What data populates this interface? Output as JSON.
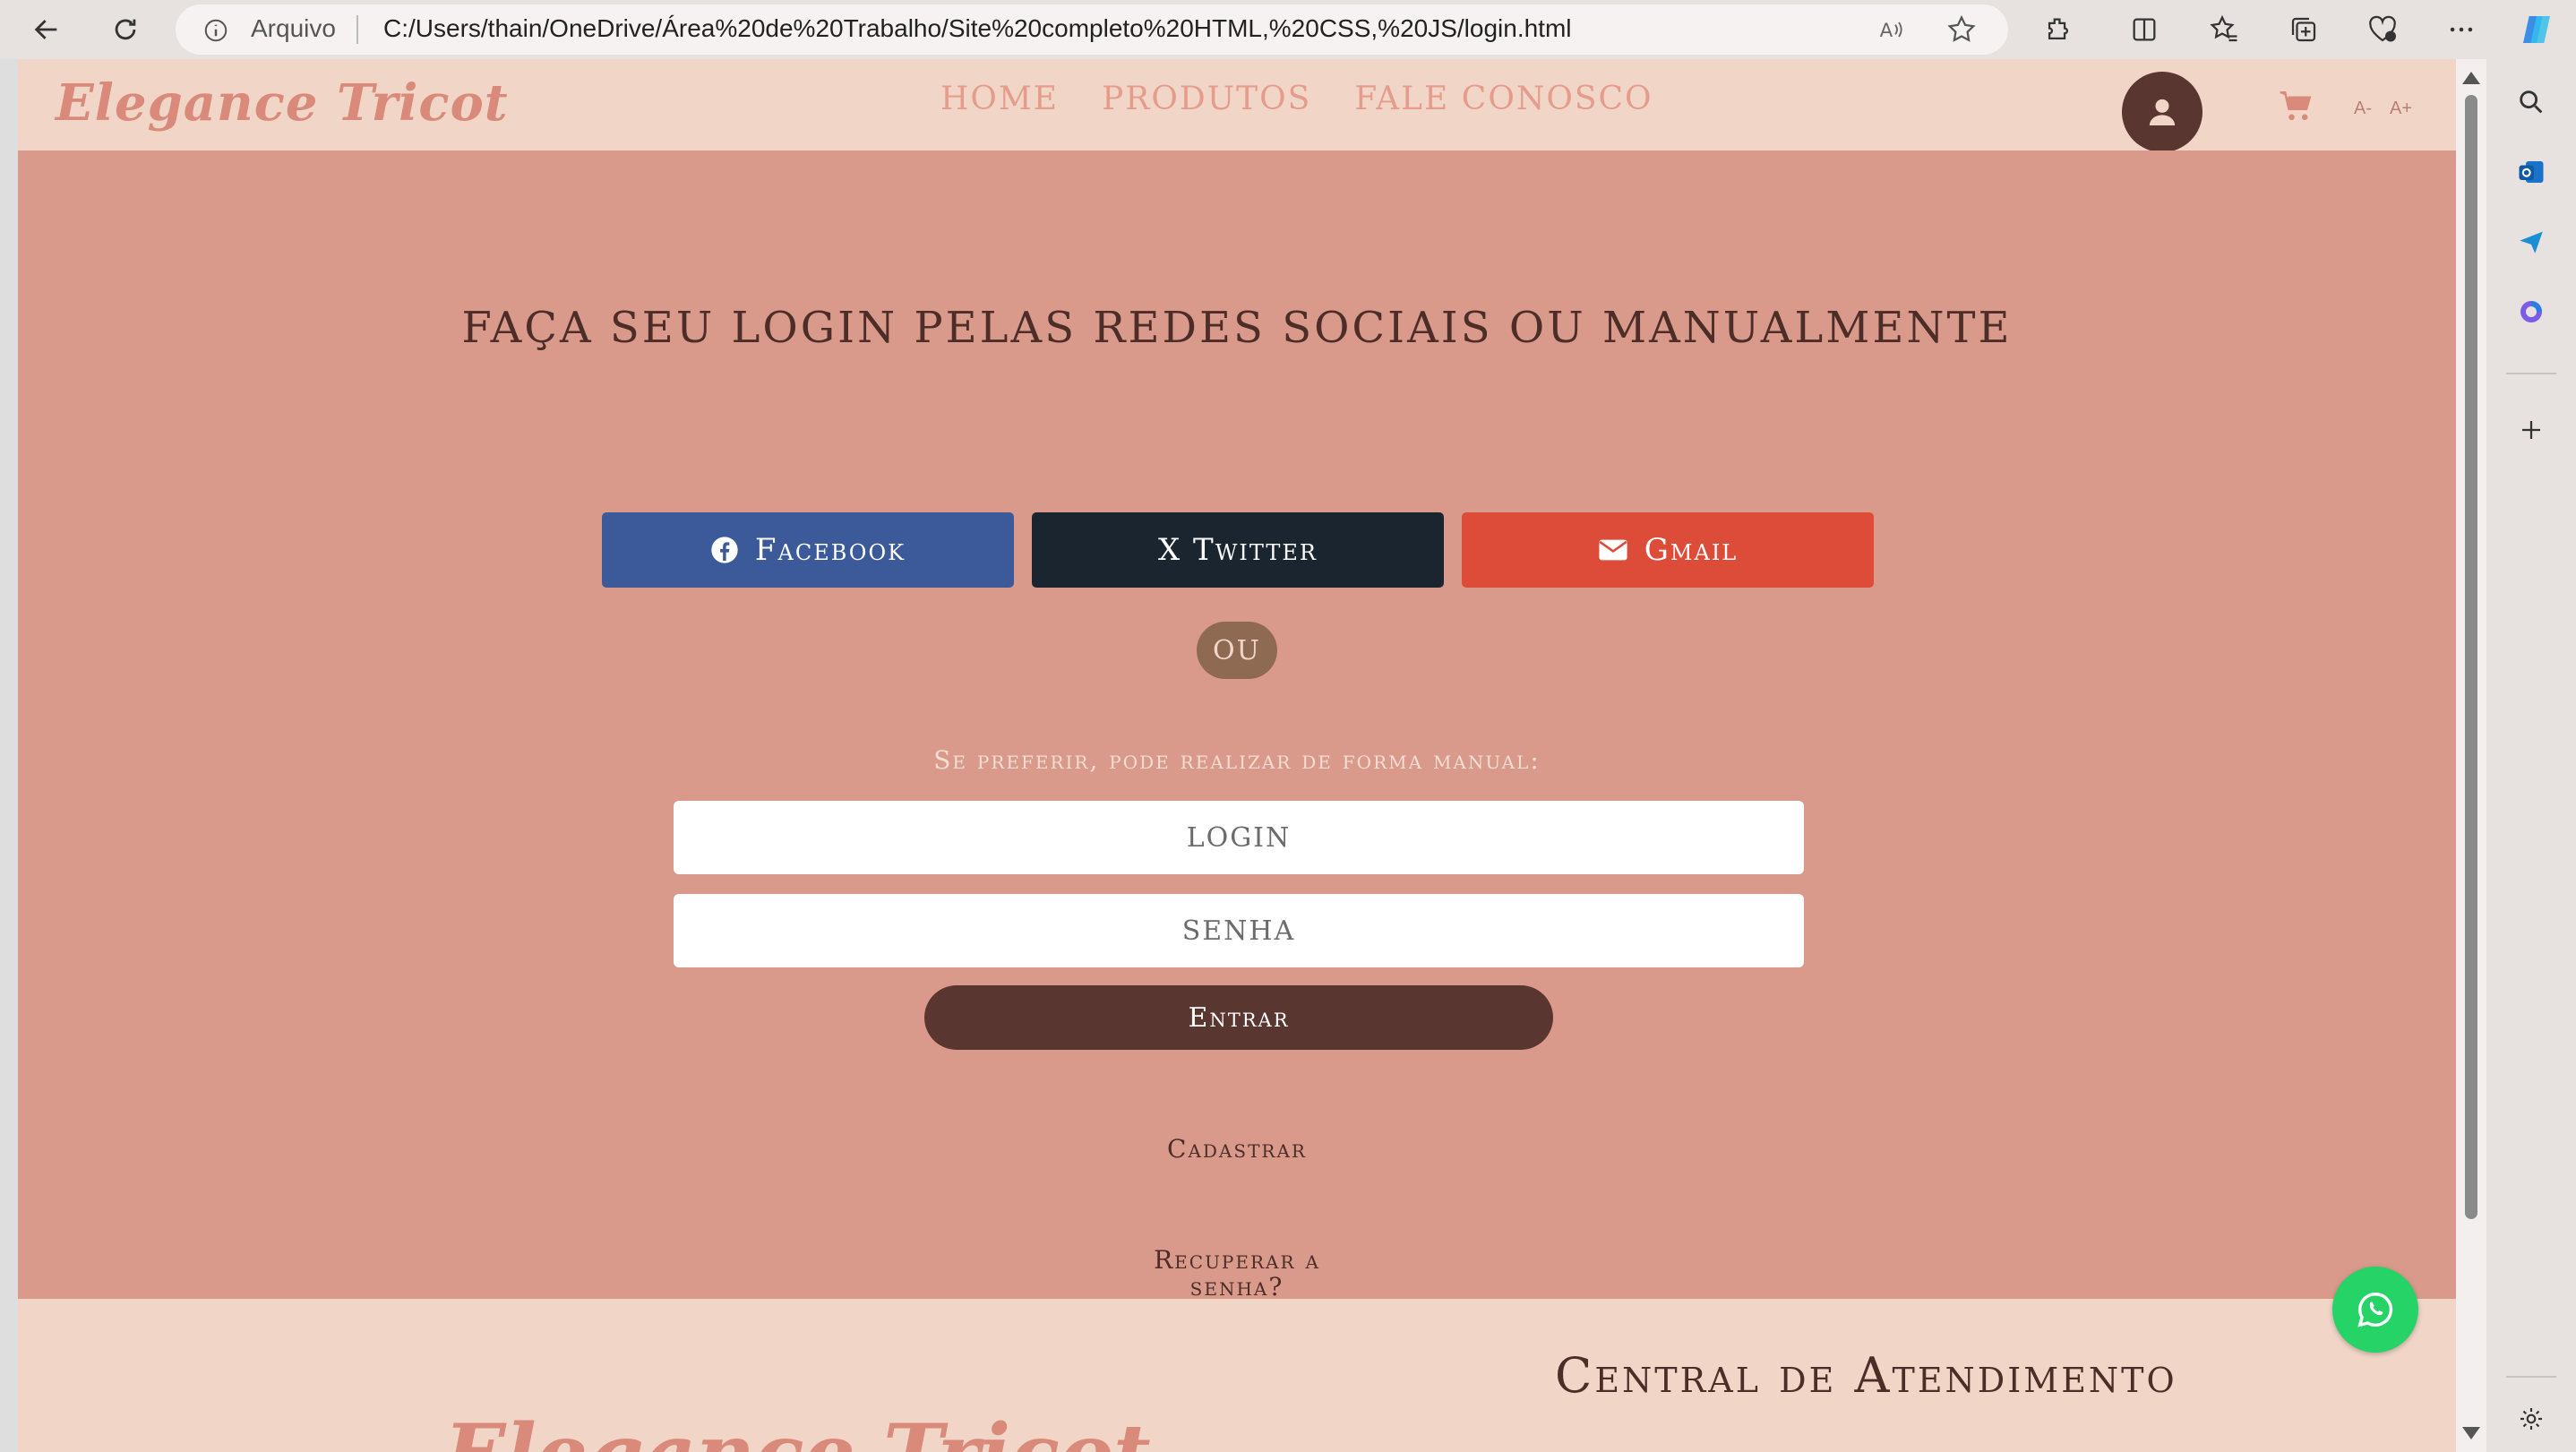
{
  "browser": {
    "address_label": "Arquivo",
    "url": "C:/Users/thain/OneDrive/Área%20de%20Trabalho/Site%20completo%20HTML,%20CSS,%20JS/login.html"
  },
  "site": {
    "logo": "Elegance Tricot",
    "nav": [
      "Home",
      "Produtos",
      "Fale Conosco"
    ],
    "font_decrease": "A-",
    "font_increase": "A+"
  },
  "login": {
    "title": "Faça seu login pelas redes sociais ou manualmente",
    "social": {
      "facebook": "Facebook",
      "twitter": "X Twitter",
      "gmail": "Gmail"
    },
    "or_label": "OU",
    "manual_hint": "Se preferir, pode realizar de forma manual:",
    "login_placeholder": "LOGIN",
    "password_placeholder": "SENHA",
    "submit": "Entrar",
    "register": "Cadastrar",
    "recover": "Recuperar a senha?"
  },
  "footer": {
    "heading": "Central de Atendimento",
    "logo": "Elegance Tricot"
  },
  "colors": {
    "header_bg": "#f1d6c8",
    "main_bg": "#d99a8b",
    "brown": "#5a3631",
    "facebook": "#3c5a99",
    "twitter": "#1b2530",
    "gmail": "#dd4b39",
    "whatsapp": "#25d366"
  }
}
